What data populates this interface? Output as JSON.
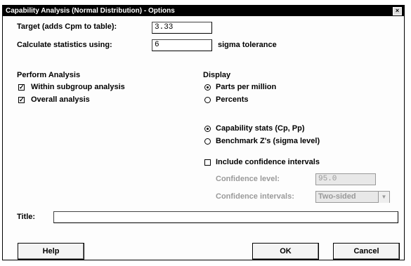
{
  "window": {
    "title": "Capability Analysis (Normal Distribution) - Options",
    "close_glyph": "×"
  },
  "target": {
    "label": "Target (adds Cpm to table):",
    "value": "3.33"
  },
  "calc": {
    "label": "Calculate statistics using:",
    "value": "6",
    "suffix": "sigma tolerance"
  },
  "perform": {
    "heading": "Perform Analysis",
    "within": {
      "label": "Within subgroup analysis",
      "checked": true
    },
    "overall": {
      "label": "Overall analysis",
      "checked": true
    }
  },
  "display": {
    "heading": "Display",
    "ppm": {
      "label": "Parts per million",
      "selected": true
    },
    "percents": {
      "label": "Percents",
      "selected": false
    },
    "capstats": {
      "label": "Capability stats (Cp, Pp)",
      "selected": true
    },
    "benchmark": {
      "label": "Benchmark Z's (sigma level)",
      "selected": false
    },
    "include_ci": {
      "label": "Include confidence intervals",
      "checked": false
    },
    "conf_level": {
      "label": "Confidence level:",
      "value": "95.0"
    },
    "conf_intervals": {
      "label": "Confidence intervals:",
      "value": "Two-sided"
    }
  },
  "title_field": {
    "label": "Title:",
    "value": ""
  },
  "buttons": {
    "help": "Help",
    "ok": "OK",
    "cancel": "Cancel"
  }
}
